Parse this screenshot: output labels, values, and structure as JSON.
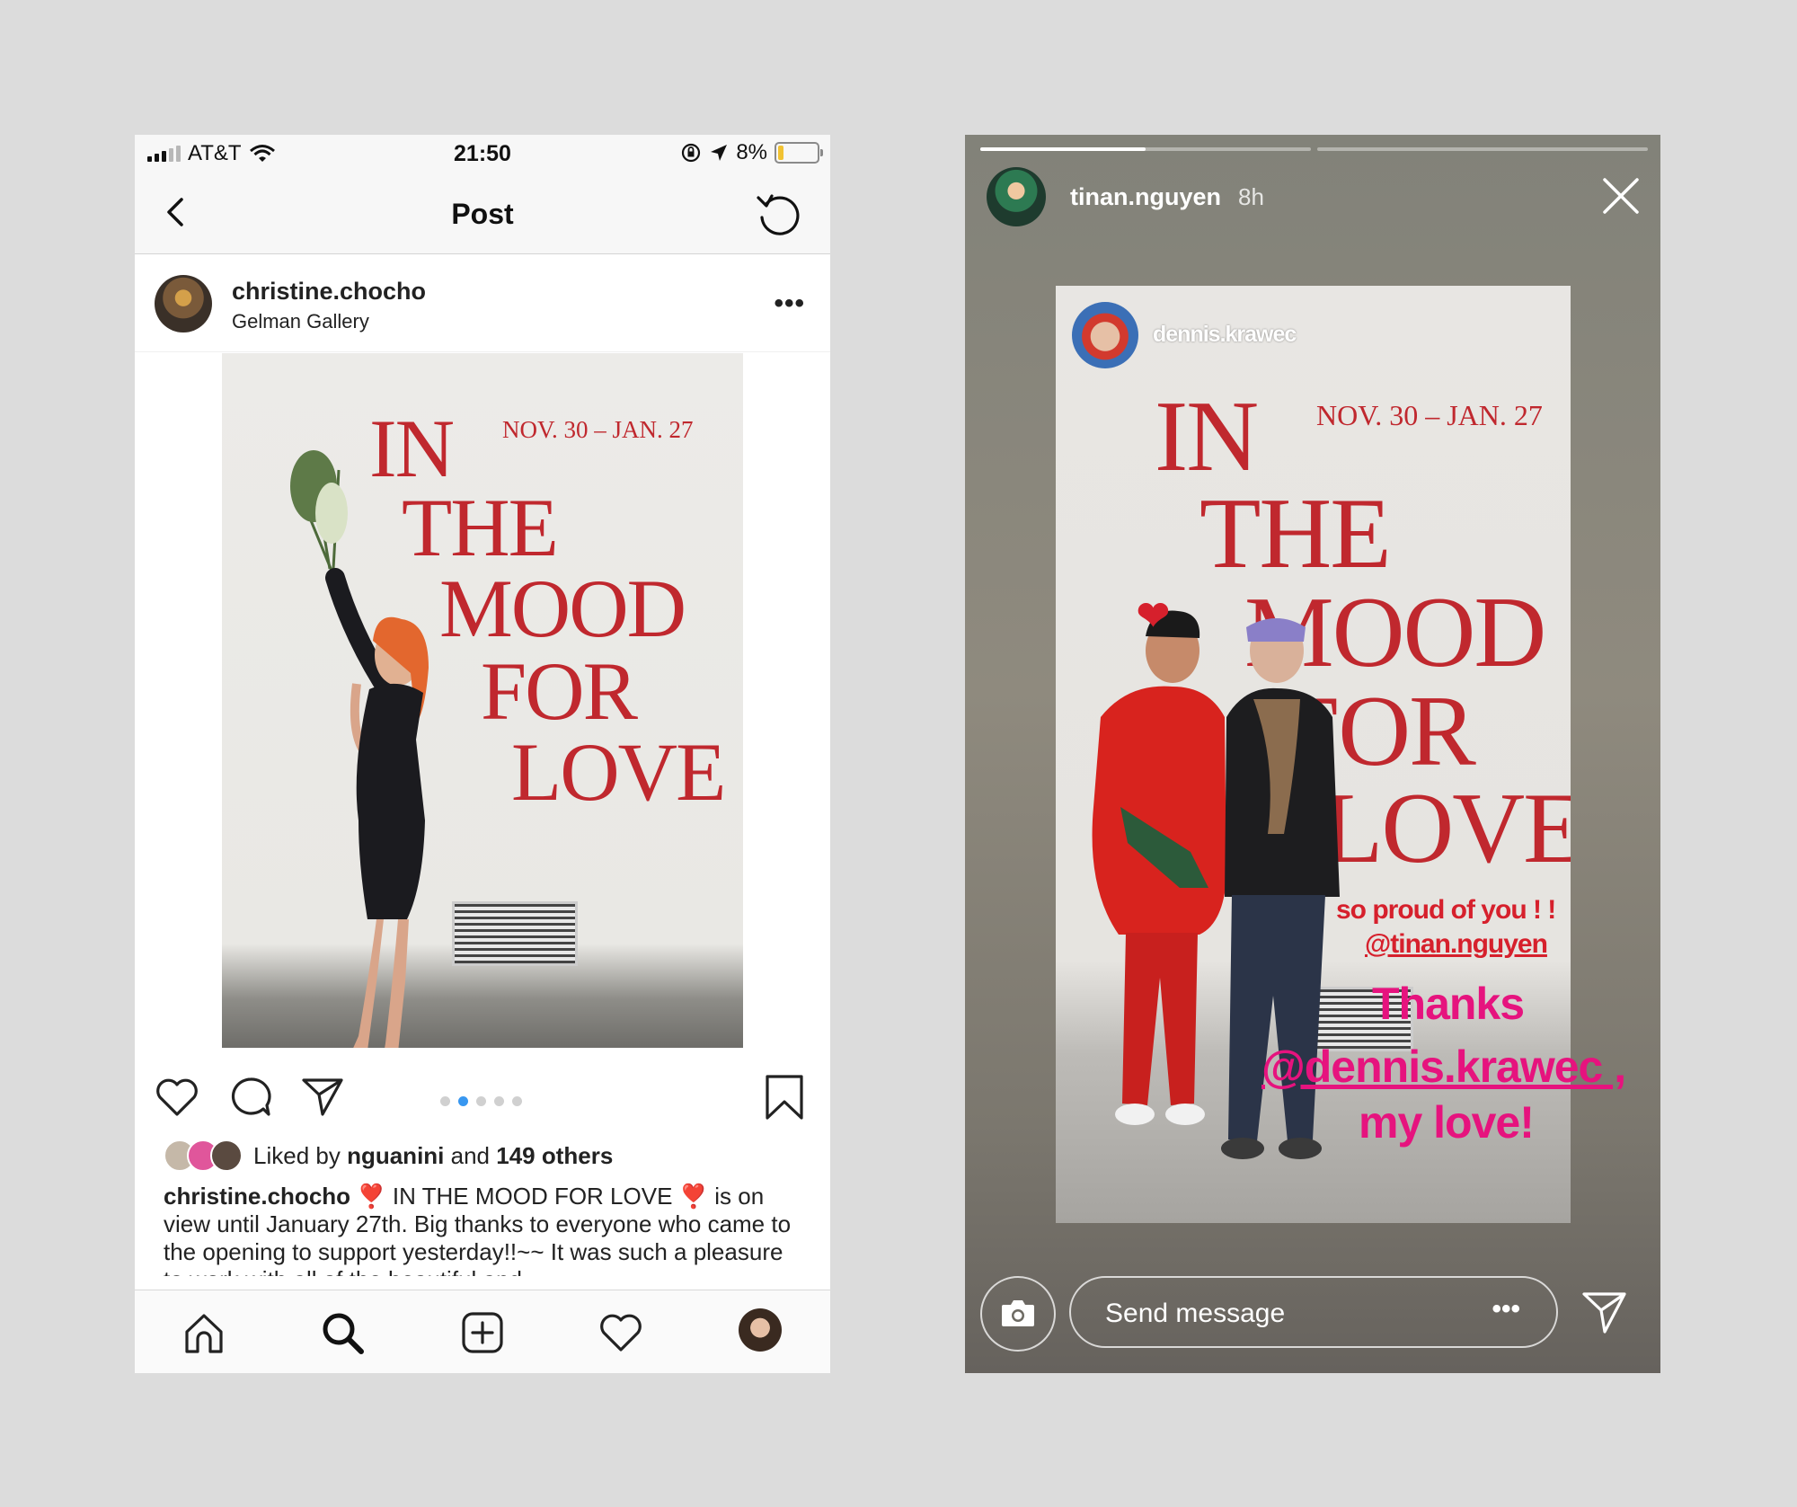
{
  "post_screen": {
    "status_bar": {
      "carrier": "AT&T",
      "time": "21:50",
      "battery": "8%"
    },
    "nav": {
      "title": "Post"
    },
    "post": {
      "username": "christine.chocho",
      "location": "Gelman Gallery",
      "more": "•••",
      "carousel": {
        "count": 5,
        "active_index": 1
      },
      "likes": {
        "prefix": "Liked by ",
        "user": "nguanini",
        "middle": " and ",
        "count": "149 others"
      },
      "caption": {
        "username": "christine.chocho",
        "text": " ❣️ IN THE MOOD FOR LOVE ❣️ is on view until January 27th. Big thanks to everyone who came to the opening to support yesterday!!~~ It was such a pleasure to work with all of the beautiful and"
      }
    },
    "poster": {
      "dates": "NOV. 30 – JAN. 27",
      "lines": [
        "IN",
        "THE",
        "MOOD",
        "FOR",
        "LOVE"
      ]
    },
    "icons": {
      "back": "chevron-left-icon",
      "refresh": "refresh-icon",
      "like": "heart-icon",
      "comment": "comment-icon",
      "share": "send-icon",
      "save": "bookmark-icon",
      "tabs": [
        "home-icon",
        "search-icon",
        "add-icon",
        "heart-icon",
        "profile-avatar"
      ]
    }
  },
  "story_screen": {
    "username": "tinan.nguyen",
    "time": "8h",
    "progress_segments": [
      0.5,
      0,
      0
    ],
    "reposted_from": "dennis.krawec",
    "stickers": {
      "line1": "so proud of you ! !",
      "line2": "@tinan.nguyen",
      "thanks1": "Thanks",
      "thanks2": "@dennis.krawec ,",
      "thanks3": "my love!"
    },
    "heart_sticker": "❤",
    "message_placeholder": "Send message",
    "message_more": "•••"
  },
  "colors": {
    "background": "#dcdcdc",
    "poster_red": "#c0282e",
    "accent_blue": "#3897f0",
    "sticker_red": "#d6202c",
    "sticker_pink": "#e6137e"
  }
}
